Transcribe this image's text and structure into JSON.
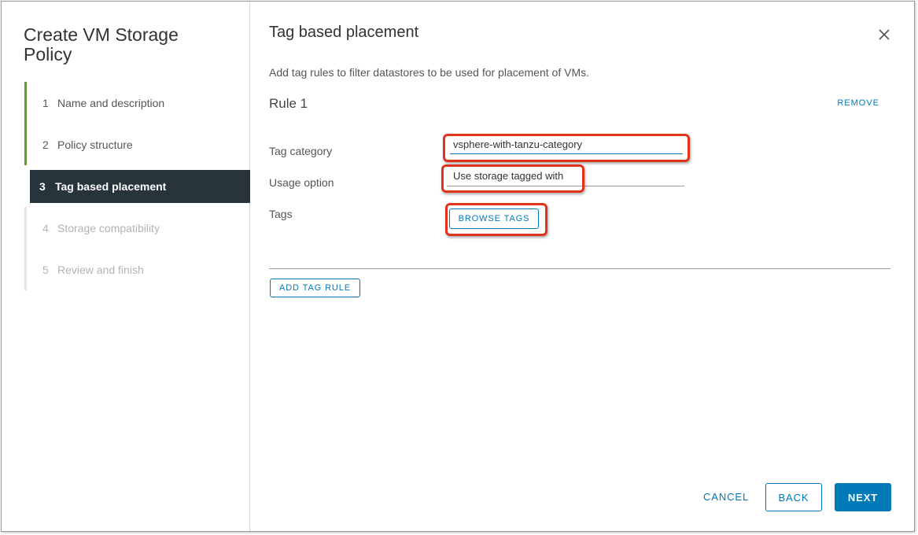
{
  "wizard": {
    "title": "Create VM Storage Policy",
    "steps": [
      {
        "number": "1",
        "label": "Name and description",
        "state": "done"
      },
      {
        "number": "2",
        "label": "Policy structure",
        "state": "done"
      },
      {
        "number": "3",
        "label": "Tag based placement",
        "state": "active"
      },
      {
        "number": "4",
        "label": "Storage compatibility",
        "state": "disabled"
      },
      {
        "number": "5",
        "label": "Review and finish",
        "state": "disabled"
      }
    ]
  },
  "page": {
    "title": "Tag based placement",
    "description": "Add tag rules to filter datastores to be used for placement of VMs.",
    "close_icon": "close-icon"
  },
  "rule": {
    "title": "Rule 1",
    "remove_label": "REMOVE",
    "tag_category_label": "Tag category",
    "tag_category_value": "vsphere-with-tanzu-category",
    "usage_option_label": "Usage option",
    "usage_option_value": "Use storage tagged with",
    "tags_label": "Tags",
    "browse_tags_label": "BROWSE TAGS"
  },
  "actions": {
    "add_tag_rule_label": "ADD TAG RULE",
    "cancel_label": "CANCEL",
    "back_label": "BACK",
    "next_label": "NEXT"
  },
  "colors": {
    "accent": "#0079b8",
    "done_step": "#5aa220",
    "active_step_bg": "#28343b",
    "highlight": "#e0331a"
  }
}
